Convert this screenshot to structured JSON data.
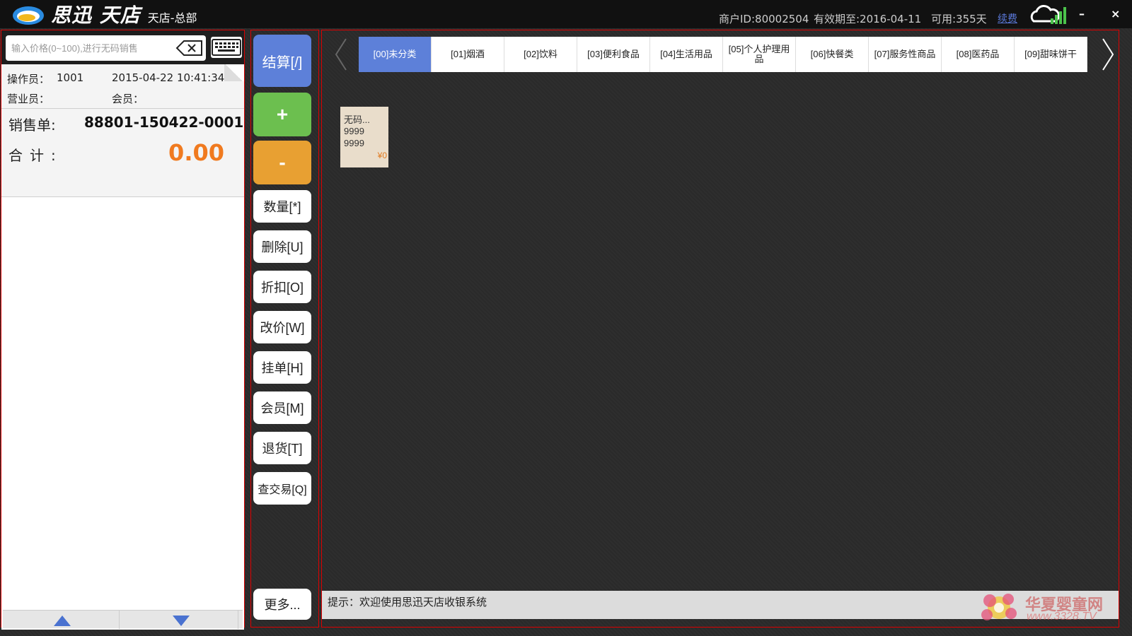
{
  "app": {
    "logo_text": "思迅",
    "logo_text2": "天店",
    "subtitle": "天店-总部"
  },
  "header": {
    "merchant_id": "商户ID:80002504",
    "valid_until": "有效期至:2016-04-11",
    "available": "可用:355天",
    "renew_label": "续费",
    "minimize_label": "–",
    "close_label": "×"
  },
  "left": {
    "search_placeholder": "输入价格(0~100),进行无码销售",
    "operator_label": "操作员：",
    "operator_value": "1001",
    "datetime": "2015-04-22 10:41:34",
    "salesperson_label": "营业员：",
    "member_label": "会员：",
    "order_label": "销售单:",
    "order_no": "88801-150422-0001",
    "total_label": "合计:",
    "total_value": "0.00"
  },
  "actions": {
    "settle": "结算[/]",
    "plus": "+",
    "minus": "-",
    "quantity": "数量[*]",
    "delete": "删除[U]",
    "discount": "折扣[O]",
    "change_price": "改价[W]",
    "hold": "挂单[H]",
    "member": "会员[M]",
    "return": "退货[T]",
    "query": "查交易[Q]",
    "more": "更多..."
  },
  "categories": [
    {
      "label": "[00]未分类",
      "active": true
    },
    {
      "label": "[01]烟酒"
    },
    {
      "label": "[02]饮料"
    },
    {
      "label": "[03]便利食品"
    },
    {
      "label": "[04]生活用品"
    },
    {
      "label": "[05]个人护理用品"
    },
    {
      "label": "[06]快餐类"
    },
    {
      "label": "[07]服务性商品"
    },
    {
      "label": "[08]医药品"
    },
    {
      "label": "[09]甜味饼干"
    }
  ],
  "products": [
    {
      "name": "无码...",
      "code1": "9999",
      "code2": "9999",
      "price": "¥0"
    }
  ],
  "tip": "提示：欢迎使用思迅天店收银系统",
  "watermark": {
    "line1": "华夏婴童网",
    "line2": "www.3328.TV"
  },
  "colors": {
    "accent_blue": "#5d80d9",
    "plus_green": "#6cbf4f",
    "minus_orange": "#e8a032",
    "total_orange": "#f07a1f"
  }
}
